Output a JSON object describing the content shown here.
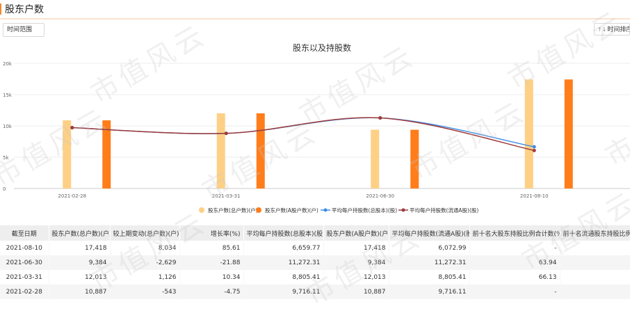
{
  "page_title": "股东户数",
  "toolbar": {
    "range_label": "时间范围",
    "sort_label": "时间排序",
    "sort_icon": "↑↓"
  },
  "watermark_text": "市值风云",
  "colors": {
    "bar_total": "#fdd086",
    "bar_a": "#ff7d1a",
    "line_total": "#3f8de6",
    "line_float": "#9e3a3a",
    "title_accent": "#f08a2c"
  },
  "chart_data": {
    "type": "bar",
    "title": "股东以及持股数",
    "categories": [
      "2021-02-28",
      "2021-03-31",
      "2021-06-30",
      "2021-08-10"
    ],
    "ylim": [
      0,
      20000
    ],
    "yticks": [
      0,
      5000,
      10000,
      15000,
      20000
    ],
    "ytick_labels": [
      "0",
      "5k",
      "10k",
      "15k",
      "20k"
    ],
    "legend_position": "bottom",
    "grid": true,
    "series": [
      {
        "name": "股东户数(总户数)(户)",
        "type": "bar",
        "color": "#fdd086",
        "values": [
          10887,
          12013,
          9384,
          17418
        ]
      },
      {
        "name": "股东户数(A股户数)(户)",
        "type": "bar",
        "color": "#ff7d1a",
        "values": [
          10887,
          12013,
          9384,
          17418
        ]
      },
      {
        "name": "平均每户持股数(总股本)(股)",
        "type": "line",
        "color": "#3f8de6",
        "values": [
          9716.11,
          8805.41,
          11272.31,
          6659.77
        ]
      },
      {
        "name": "平均每户持股数(流通A股)(股)",
        "type": "line",
        "color": "#9e3a3a",
        "values": [
          9716.11,
          8805.41,
          11272.31,
          6072.99
        ]
      }
    ]
  },
  "table": {
    "headers": [
      "截至日期",
      "股东户数(总户数)(户)",
      "较上期变动(总户数)(户)",
      "增长率(%)",
      "平均每户持股数(总股本)(股)",
      "股东户数(A股户数)(户)",
      "平均每户持股数(流通A股)(股)",
      "前十名大股东持股比例合计数(%)",
      "前十名流通股东持股比例合计数(%)"
    ],
    "rows": [
      [
        "2021-08-10",
        "17,418",
        "8,034",
        "85.61",
        "6,659.77",
        "17,418",
        "6,072.99",
        "-",
        ""
      ],
      [
        "2021-06-30",
        "9,384",
        "-2,629",
        "-21.88",
        "11,272.31",
        "9,384",
        "11,272.31",
        "63.94",
        ""
      ],
      [
        "2021-03-31",
        "12,013",
        "1,126",
        "10.34",
        "8,805.41",
        "12,013",
        "8,805.41",
        "66.13",
        ""
      ],
      [
        "2021-02-28",
        "10,887",
        "-543",
        "-4.75",
        "9,716.11",
        "10,887",
        "9,716.11",
        "-",
        ""
      ]
    ]
  }
}
